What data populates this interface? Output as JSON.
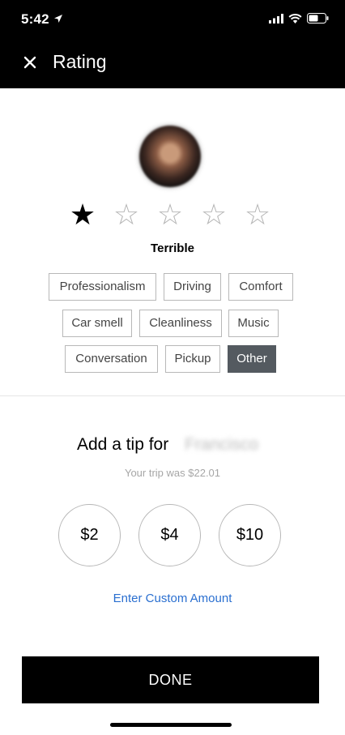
{
  "status_bar": {
    "time": "5:42",
    "location_icon": "location-arrow-icon",
    "signal_icon": "cellular-signal-icon",
    "wifi_icon": "wifi-icon",
    "battery_icon": "battery-icon"
  },
  "header": {
    "close_icon": "close-icon",
    "title": "Rating"
  },
  "driver": {
    "avatar_icon": "driver-avatar"
  },
  "rating": {
    "value": 1,
    "max": 5,
    "label": "Terrible",
    "tags": [
      {
        "label": "Professionalism",
        "selected": false
      },
      {
        "label": "Driving",
        "selected": false
      },
      {
        "label": "Comfort",
        "selected": false
      },
      {
        "label": "Car smell",
        "selected": false
      },
      {
        "label": "Cleanliness",
        "selected": false
      },
      {
        "label": "Music",
        "selected": false
      },
      {
        "label": "Conversation",
        "selected": false
      },
      {
        "label": "Pickup",
        "selected": false
      },
      {
        "label": "Other",
        "selected": true
      }
    ]
  },
  "tip": {
    "heading": "Add a tip for",
    "driver_name": "Francisco",
    "trip_summary": "Your trip was $22.01",
    "options": [
      "$2",
      "$4",
      "$10"
    ],
    "custom_amount_label": "Enter Custom Amount"
  },
  "actions": {
    "done_label": "DONE"
  },
  "colors": {
    "header_bg": "#000000",
    "selected_tag_bg": "#545a60",
    "link": "#2a6fd0"
  }
}
